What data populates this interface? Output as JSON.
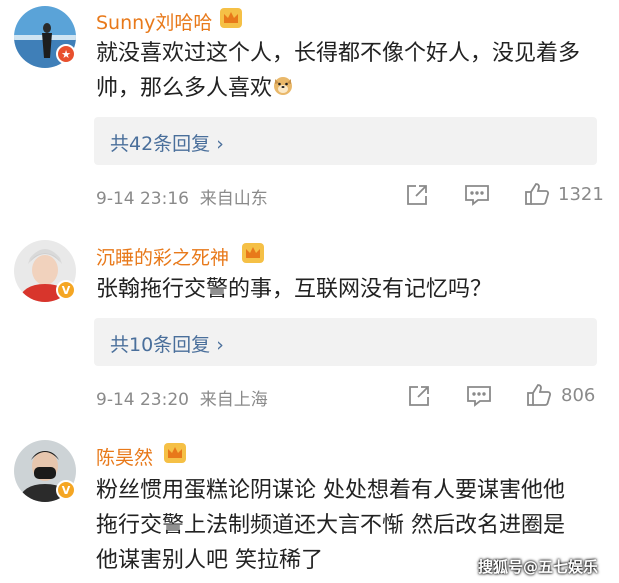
{
  "comments": [
    {
      "username": "Sunny刘哈哈",
      "text": "就没喜欢过这个人，长得都不像个好人，没见着多帅，那么多人喜欢",
      "emoji": "doge-emoji",
      "replies": "共42条回复",
      "time": "9-14 23:16",
      "location": "来自山东",
      "likes": "1321",
      "badge_color": "#e8502e"
    },
    {
      "username": "沉睡的彩之死神",
      "text": "张翰拖行交警的事，互联网没有记忆吗？",
      "replies": "共10条回复",
      "time": "9-14 23:20",
      "location": "来自上海",
      "likes": "806",
      "badge_color": "#f5a623"
    },
    {
      "username": "陈昊然",
      "text": "粉丝惯用蛋糕论阴谋论 处处想着有人要谋害他他拖行交警上法制频道还大言不惭 然后改名进圈是他谋害别人吧 笑拉稀了",
      "badge_color": "#f5a623"
    }
  ],
  "watermark": "搜狐号@五七娱乐",
  "colors": {
    "username": "#e8791a",
    "link": "#4a6f9b",
    "meta": "#8a8a8a"
  }
}
